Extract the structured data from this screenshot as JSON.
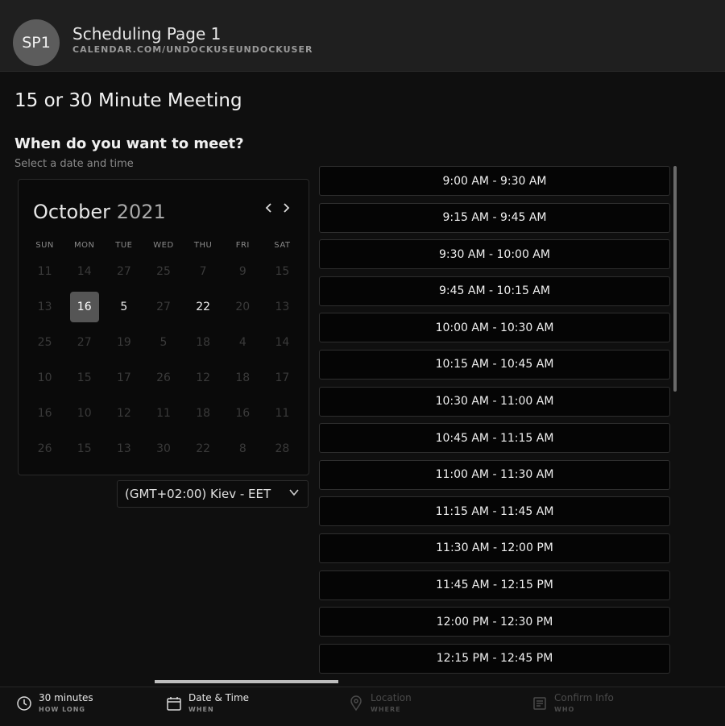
{
  "header": {
    "avatar_initials": "SP1",
    "org_name": "Scheduling Page 1",
    "org_url": "CALENDAR.COM/UNDOCKUSEUNDOCKUSER"
  },
  "meeting": {
    "title": "15 or 30 Minute Meeting",
    "question": "When do you want to meet?",
    "subtitle": "Select a date and time"
  },
  "calendar": {
    "month": "October",
    "year": "2021",
    "weekdays": [
      "SUN",
      "MON",
      "TUE",
      "WED",
      "THU",
      "FRI",
      "SAT"
    ],
    "days": [
      {
        "d": "11",
        "a": false
      },
      {
        "d": "14",
        "a": false
      },
      {
        "d": "27",
        "a": false
      },
      {
        "d": "25",
        "a": false
      },
      {
        "d": "7",
        "a": false
      },
      {
        "d": "9",
        "a": false
      },
      {
        "d": "15",
        "a": false
      },
      {
        "d": "13",
        "a": false
      },
      {
        "d": "16",
        "a": true,
        "sel": true
      },
      {
        "d": "5",
        "a": true
      },
      {
        "d": "27",
        "a": false
      },
      {
        "d": "22",
        "a": true
      },
      {
        "d": "20",
        "a": false
      },
      {
        "d": "13",
        "a": false
      },
      {
        "d": "25",
        "a": false
      },
      {
        "d": "27",
        "a": false
      },
      {
        "d": "19",
        "a": false
      },
      {
        "d": "5",
        "a": false
      },
      {
        "d": "18",
        "a": false
      },
      {
        "d": "4",
        "a": false
      },
      {
        "d": "14",
        "a": false
      },
      {
        "d": "10",
        "a": false
      },
      {
        "d": "15",
        "a": false
      },
      {
        "d": "17",
        "a": false
      },
      {
        "d": "26",
        "a": false
      },
      {
        "d": "12",
        "a": false
      },
      {
        "d": "18",
        "a": false
      },
      {
        "d": "17",
        "a": false
      },
      {
        "d": "16",
        "a": false
      },
      {
        "d": "10",
        "a": false
      },
      {
        "d": "12",
        "a": false
      },
      {
        "d": "11",
        "a": false
      },
      {
        "d": "18",
        "a": false
      },
      {
        "d": "16",
        "a": false
      },
      {
        "d": "11",
        "a": false
      },
      {
        "d": "26",
        "a": false
      },
      {
        "d": "15",
        "a": false
      },
      {
        "d": "13",
        "a": false
      },
      {
        "d": "30",
        "a": false
      },
      {
        "d": "22",
        "a": false
      },
      {
        "d": "8",
        "a": false
      },
      {
        "d": "28",
        "a": false
      }
    ]
  },
  "timezone": {
    "label": "(GMT+02:00) Kiev - EET"
  },
  "slots": [
    "9:00 AM - 9:30 AM",
    "9:15 AM - 9:45 AM",
    "9:30 AM - 10:00 AM",
    "9:45 AM - 10:15 AM",
    "10:00 AM - 10:30 AM",
    "10:15 AM - 10:45 AM",
    "10:30 AM - 11:00 AM",
    "10:45 AM - 11:15 AM",
    "11:00 AM - 11:30 AM",
    "11:15 AM - 11:45 AM",
    "11:30 AM - 12:00 PM",
    "11:45 AM - 12:15 PM",
    "12:00 PM - 12:30 PM",
    "12:15 PM - 12:45 PM"
  ],
  "footer": {
    "steps": [
      {
        "label": "30 minutes",
        "sub": "HOW LONG"
      },
      {
        "label": "Date & Time",
        "sub": "WHEN"
      },
      {
        "label": "Location",
        "sub": "WHERE"
      },
      {
        "label": "Confirm Info",
        "sub": "WHO"
      }
    ]
  }
}
